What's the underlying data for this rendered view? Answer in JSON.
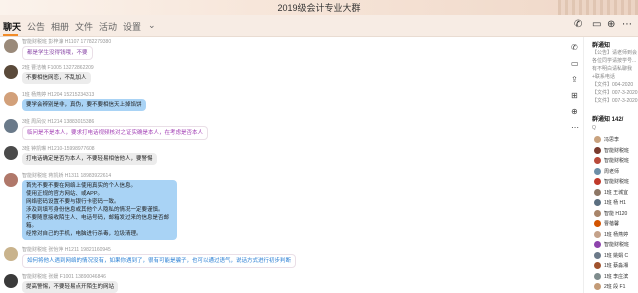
{
  "window": {
    "title": "2019级会计专业大群"
  },
  "tabs": [
    {
      "label": "聊天"
    },
    {
      "label": "公告"
    },
    {
      "label": "相册"
    },
    {
      "label": "文件"
    },
    {
      "label": "活动"
    },
    {
      "label": "设置"
    }
  ],
  "messages": [
    {
      "sender": "智能财税班 彭梓濠 H1107 17782279380",
      "lines": [
        "都是学生没得钱哦，不要"
      ],
      "style": "purple"
    },
    {
      "sender": "2班 曹洁楠 F1005 13272862209",
      "lines": [
        "不要相信网恋，不乱加人"
      ],
      "style": "gray"
    },
    {
      "sender": "1班 杨燕婷 H1204 15215234313",
      "lines": [
        "要学会辨别是非，真伪，要不要相信天上掉馅饼"
      ],
      "style": "blue"
    },
    {
      "sender": "3班 周凤仪 H1214 13883015386",
      "lines": [
        "临问是不是本人，要求打电话视频核对之证实确是本人，在考虑是否本人"
      ],
      "style": "white"
    },
    {
      "sender": "3班 钟凯琳 H1210-15998977608",
      "lines": [
        "打电话确定是否为本人，不要轻易相信他人，要警惕"
      ],
      "style": "gray"
    },
    {
      "sender": "智能财税班 蒋凯娇 H1311 18983922614",
      "lines": [
        "首先不要不要在网络上使用真实的个人信息。",
        "使用正规的官方网站、或APP。",
        "网络密码设置不要与银行卡密码一致。",
        "涉及到填写身份信息或其他个人隐私的情况一定要谨慎。",
        "不要随意接收陌生人、电话号码，邮箱发过来的信息是否邮箱。",
        "经常对自己的手机，电脑进行杀毒，垃圾清理。"
      ],
      "style": "blue"
    },
    {
      "sender": "智能财税班 张怡萍 H1211 19821160945",
      "lines": [
        "如何将他人遇到网络的情况没有，如果你遇到了，很有可能是骗子，也可以通过语气，说话方式进行初步判断"
      ],
      "style": "white"
    },
    {
      "sender": "智能财税班 张媛 F1001 13890046846",
      "lines": [
        "提高警惕，不要轻易点开陌生的网站"
      ],
      "style": "gray"
    }
  ],
  "side": {
    "notice_title": "群通知",
    "notice_lines": [
      "【公告】请老师到会",
      "各位同学请按学号...",
      "有不明白请私聊我",
      "+联系电话",
      "【文件】004-2020",
      "【文件】007-3-2020",
      "【文件】007-3-2020"
    ],
    "members_title": "群通知 142/",
    "search_placeholder": "Q",
    "members": [
      "冯思李",
      "智能财税班",
      "智能财税班",
      "周老师",
      "智能财税班",
      "1班 王城宜",
      "1班 杨 H1",
      "智能 H120",
      "曹蓓馨",
      "1班 杨燕婷",
      "智能财税班",
      "1班 姚娟 C",
      "1班 蔡淼湘",
      "1班 李庄滨",
      "2班 段 F1"
    ],
    "member_colors": [
      "#c9a27e",
      "#7a3b2e",
      "#b84a3a",
      "#6d8fa8",
      "#c0392b",
      "#8d7766",
      "#5b6f80",
      "#a8856a",
      "#d35400",
      "#c4a28a",
      "#8e44ad",
      "#6c7a89",
      "#a0522d",
      "#7f8c8d",
      "#c39b77"
    ]
  },
  "avatar_colors": [
    "#9a8a7a",
    "#5a4a3a",
    "#d2a07a",
    "#6a7a8a",
    "#4a4a4a",
    "#b0786a",
    "#c9b38c",
    "#3a3a3a"
  ]
}
